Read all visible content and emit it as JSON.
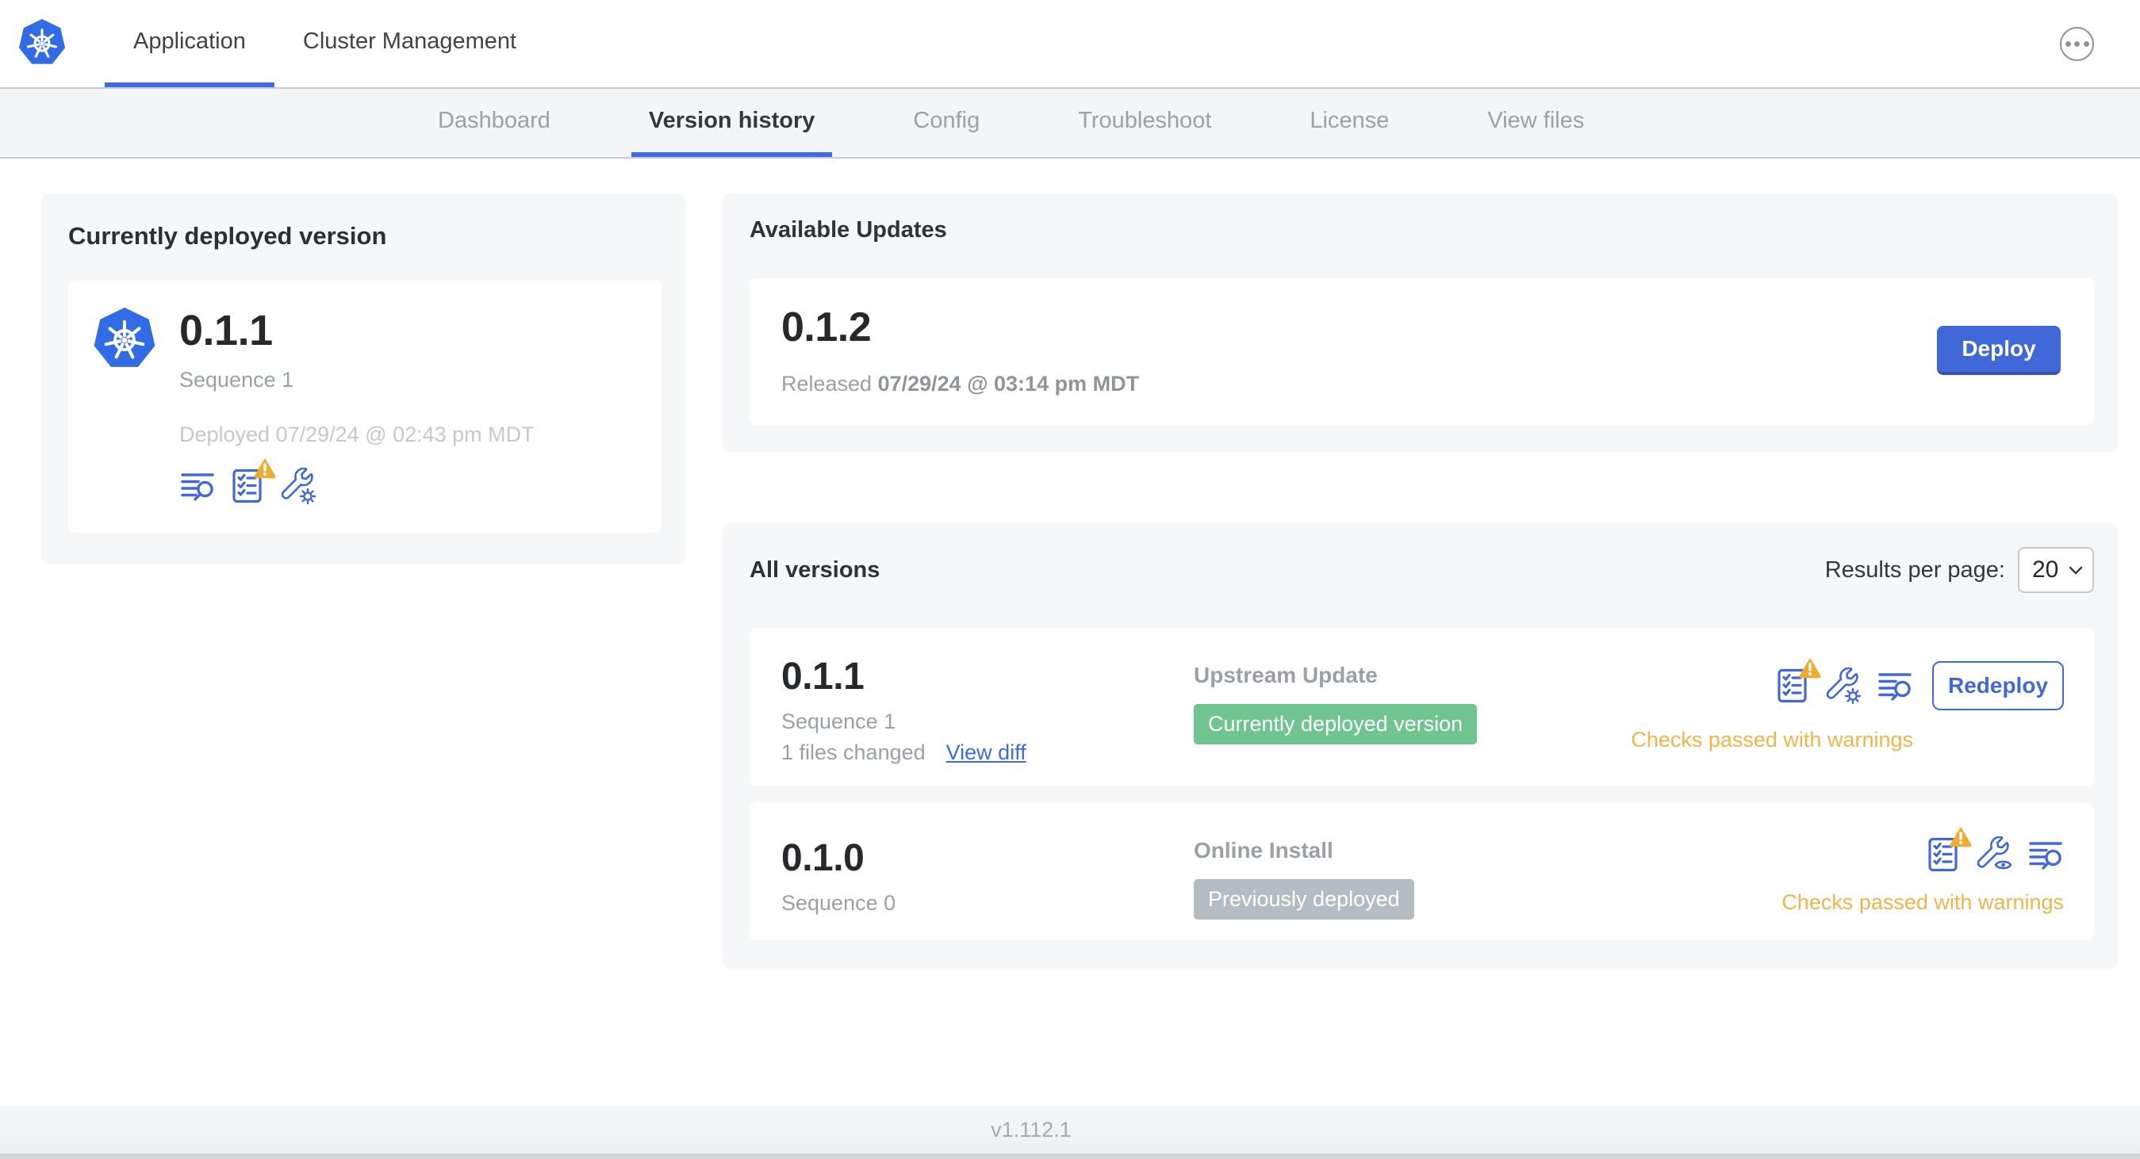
{
  "colors": {
    "primary_blue": "#4168d9",
    "k8s_blue": "#326ce5",
    "badge_green": "#6fc48f",
    "badge_gray": "#b4bdc2",
    "warning_yellow": "#ecb64a",
    "panel_gray": "#f6f7f9"
  },
  "header": {
    "tabs": [
      {
        "label": "Application",
        "active": true
      },
      {
        "label": "Cluster Management",
        "active": false
      }
    ]
  },
  "subnav": {
    "items": [
      {
        "label": "Dashboard",
        "active": false
      },
      {
        "label": "Version history",
        "active": true
      },
      {
        "label": "Config",
        "active": false
      },
      {
        "label": "Troubleshoot",
        "active": false
      },
      {
        "label": "License",
        "active": false
      },
      {
        "label": "View files",
        "active": false
      }
    ]
  },
  "current_version": {
    "title": "Currently deployed version",
    "version": "0.1.1",
    "sequence": "Sequence 1",
    "deployed": "Deployed 07/29/24 @ 02:43 pm MDT"
  },
  "available_updates": {
    "title": "Available Updates",
    "version": "0.1.2",
    "released_prefix": "Released",
    "released_date": "07/29/24 @ 03:14 pm MDT",
    "deploy_label": "Deploy"
  },
  "all_versions": {
    "title": "All versions",
    "results_per_page_label": "Results per page:",
    "results_per_page_value": "20",
    "rows": [
      {
        "version": "0.1.1",
        "sequence": "Sequence 1",
        "files_changed": "1 files changed",
        "view_diff_label": "View diff",
        "source": "Upstream Update",
        "badge": "Currently deployed version",
        "badge_type": "green",
        "checks": "Checks passed with warnings",
        "action_label": "Redeploy"
      },
      {
        "version": "0.1.0",
        "sequence": "Sequence 0",
        "source": "Online Install",
        "badge": "Previously deployed",
        "badge_type": "gray",
        "checks": "Checks passed with warnings"
      }
    ]
  },
  "footer": {
    "version": "v1.112.1"
  }
}
